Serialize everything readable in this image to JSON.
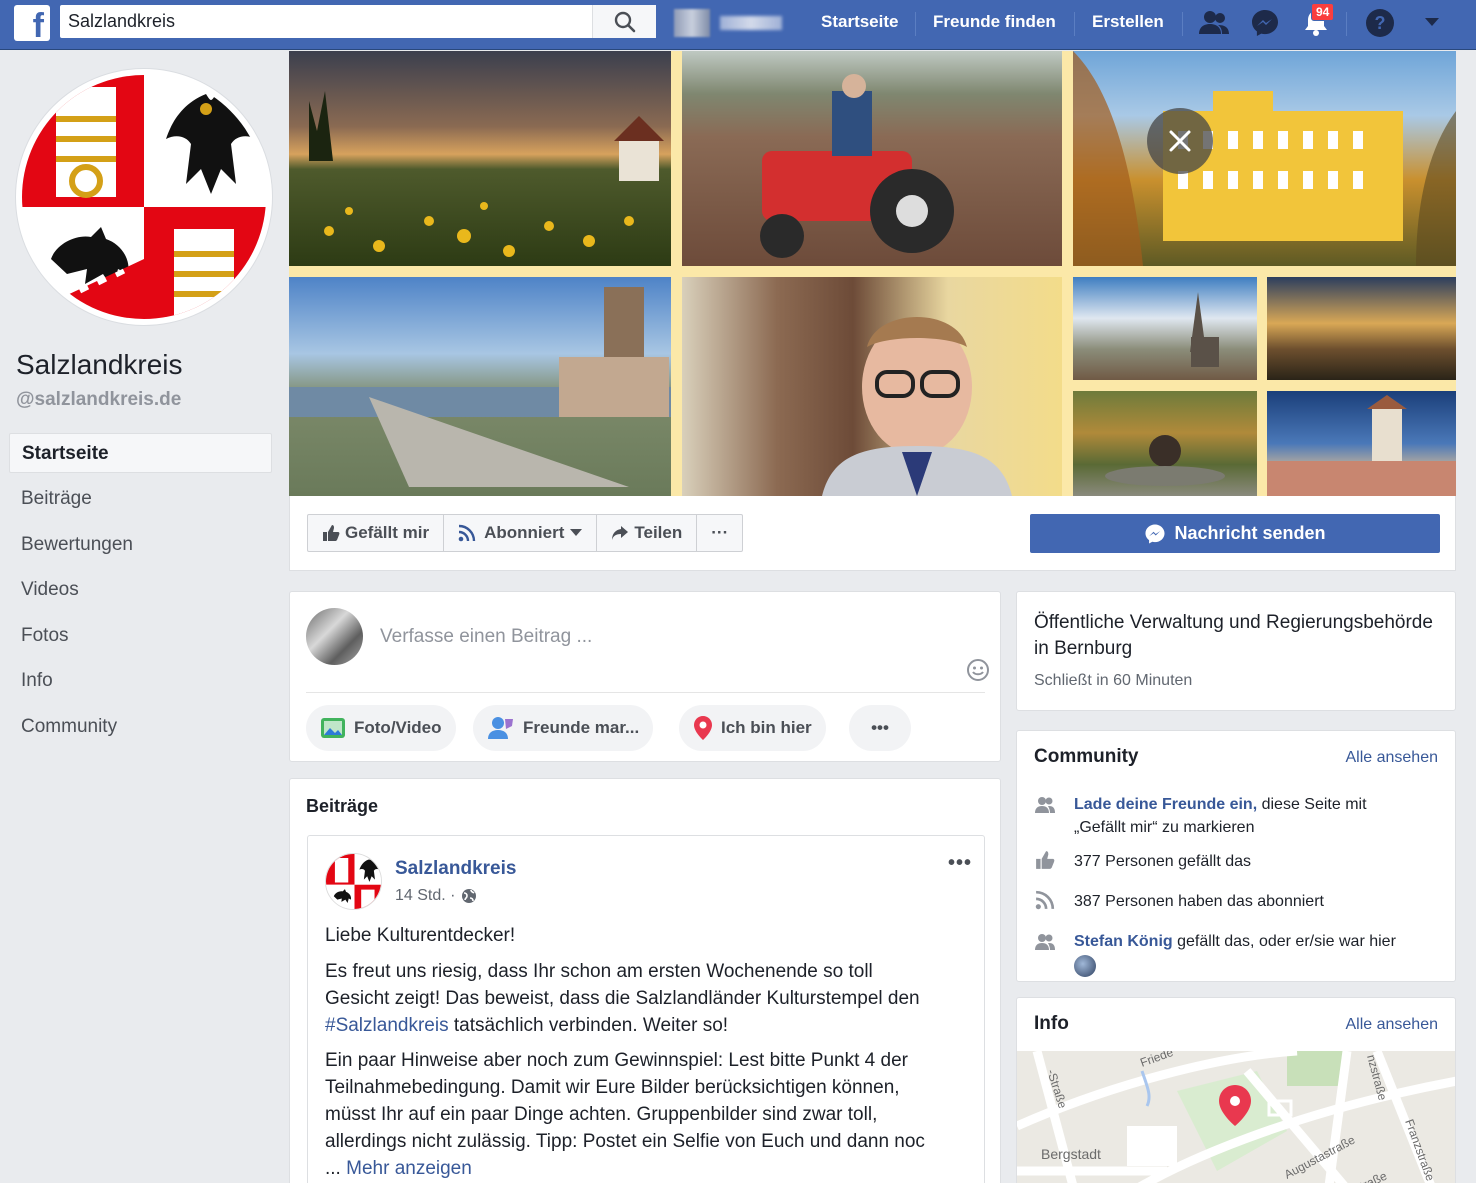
{
  "topbar": {
    "search_value": "Salzlandkreis",
    "nav": [
      "Startseite",
      "Freunde finden",
      "Erstellen"
    ],
    "notifications_count": "94",
    "icons": [
      "facebook-logo-icon",
      "search-icon",
      "friends-icon",
      "messenger-icon",
      "bell-icon",
      "help-icon",
      "chevron-down-icon"
    ]
  },
  "page": {
    "name": "Salzlandkreis",
    "handle": "@salzlandkreis.de"
  },
  "left_nav": [
    "Startseite",
    "Beiträge",
    "Bewertungen",
    "Videos",
    "Fotos",
    "Info",
    "Community"
  ],
  "actions": {
    "like": "Gefällt mir",
    "subscribed": "Abonniert",
    "share": "Teilen",
    "more": "···",
    "message": "Nachricht senden"
  },
  "composer": {
    "placeholder": "Verfasse einen Beitrag ...",
    "chips": [
      "Foto/Video",
      "Freunde mar...",
      "Ich bin hier",
      "•••"
    ]
  },
  "posts": {
    "title": "Beiträge",
    "post": {
      "author": "Salzlandkreis",
      "time": "14 Std. ·",
      "more": "•••",
      "p1": "Liebe Kulturentdecker!",
      "p2_l1": "Es freut uns riesig, dass Ihr schon am ersten Wochenende so toll",
      "p2_l2": "Gesicht zeigt! Das beweist, dass die Salzlandländer Kulturstempel den",
      "p2_hashtag": "#Salzlandkreis",
      "p2_l3_rest": " tatsächlich verbinden. Weiter so!",
      "p3_l1": "Ein paar Hinweise aber noch zum Gewinnspiel: Lest bitte Punkt 4 der",
      "p3_l2": "Teilnahmebedingung. Damit wir Eure Bilder berücksichtigen können,",
      "p3_l3": "müsst Ihr auf ein paar Dinge achten. Gruppenbilder sind zwar toll,",
      "p3_l4": "allerdings nicht zulässig. Tipp: Postet ein Selfie von Euch und dann noc",
      "ellipsis": "... ",
      "more_link": "Mehr anzeigen"
    }
  },
  "about": {
    "category": "Öffentliche Verwaltung und Regierungsbehörde in Bernburg",
    "hours": "Schließt in 60 Minuten"
  },
  "community": {
    "title": "Community",
    "see_all": "Alle ansehen",
    "invite_link": "Lade deine Freunde ein,",
    "invite_rest": " diese Seite mit",
    "invite_l2": "„Gefällt mir“ zu markieren",
    "likes": "377 Personen gefällt das",
    "follows": "387 Personen haben das abonniert",
    "friend": "Stefan König",
    "friend_rest": " gefällt das, oder er/sie war hier"
  },
  "info": {
    "title": "Info",
    "see_all": "Alle ansehen",
    "map_labels": [
      "Bergstadt",
      "Augustastraße",
      "-Straße",
      "Friede",
      "straße",
      "Franzstraße",
      "nzstraße"
    ]
  },
  "colors": {
    "brand": "#4267b2",
    "link": "#385898",
    "badge": "#fa3e3e"
  }
}
